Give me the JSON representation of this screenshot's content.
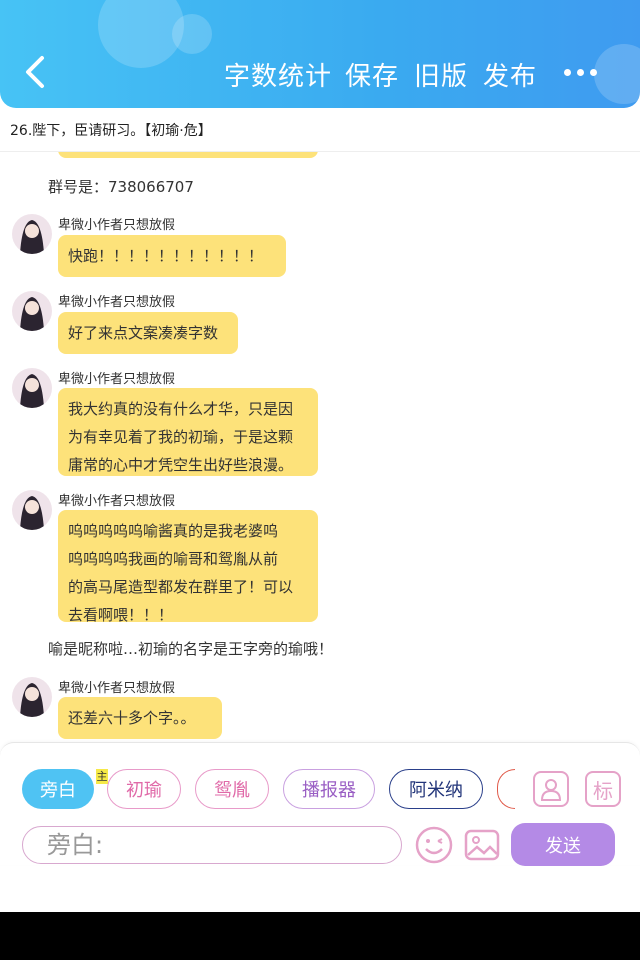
{
  "header": {
    "back_icon": "chevron-left-icon",
    "menu": [
      "字数统计",
      "保存",
      "旧版",
      "发布"
    ],
    "more_icon": "more-dots-icon",
    "bg_color": "#3aaaf0"
  },
  "chapter": {
    "title": "26.陛下，臣请研习。【初瑜·危】"
  },
  "chat": {
    "narration_1": "群号是：738066707",
    "messages": [
      {
        "author": "卑微小作者只想放假",
        "text": "快跑！！！！！！！！！！！"
      },
      {
        "author": "卑微小作者只想放假",
        "text": "好了来点文案凑凑字数"
      },
      {
        "author": "卑微小作者只想放假",
        "lines": [
          "我大约真的没有什么才华，只是因",
          "为有幸见着了我的初瑜，于是这颗",
          "庸常的心中才凭空生出好些浪漫。"
        ]
      },
      {
        "author": "卑微小作者只想放假",
        "lines": [
          "呜呜呜呜呜喻酱真的是我老婆呜",
          "呜呜呜呜我画的喻哥和鸳胤从前",
          "的高马尾造型都发在群里了！可以",
          "去看啊喂！！！"
        ]
      },
      {
        "author": "卑微小作者只想放假",
        "text": "还差六十多个字。。"
      }
    ],
    "narration_2": "喻是昵称啦…初瑜的名字是王字旁的瑜哦！",
    "bubble_color": "#fde27a"
  },
  "panel": {
    "chips": [
      "旁白",
      "初瑜",
      "鸳胤",
      "播报器",
      "阿米纳"
    ],
    "zhu_badge": "主",
    "icon_person": "person-icon",
    "tag_label": "标",
    "input_placeholder": "旁白:",
    "emoji_icon": "emoji-icon",
    "image_icon": "image-icon",
    "send_label": "发送",
    "send_color": "#b48ae6"
  }
}
